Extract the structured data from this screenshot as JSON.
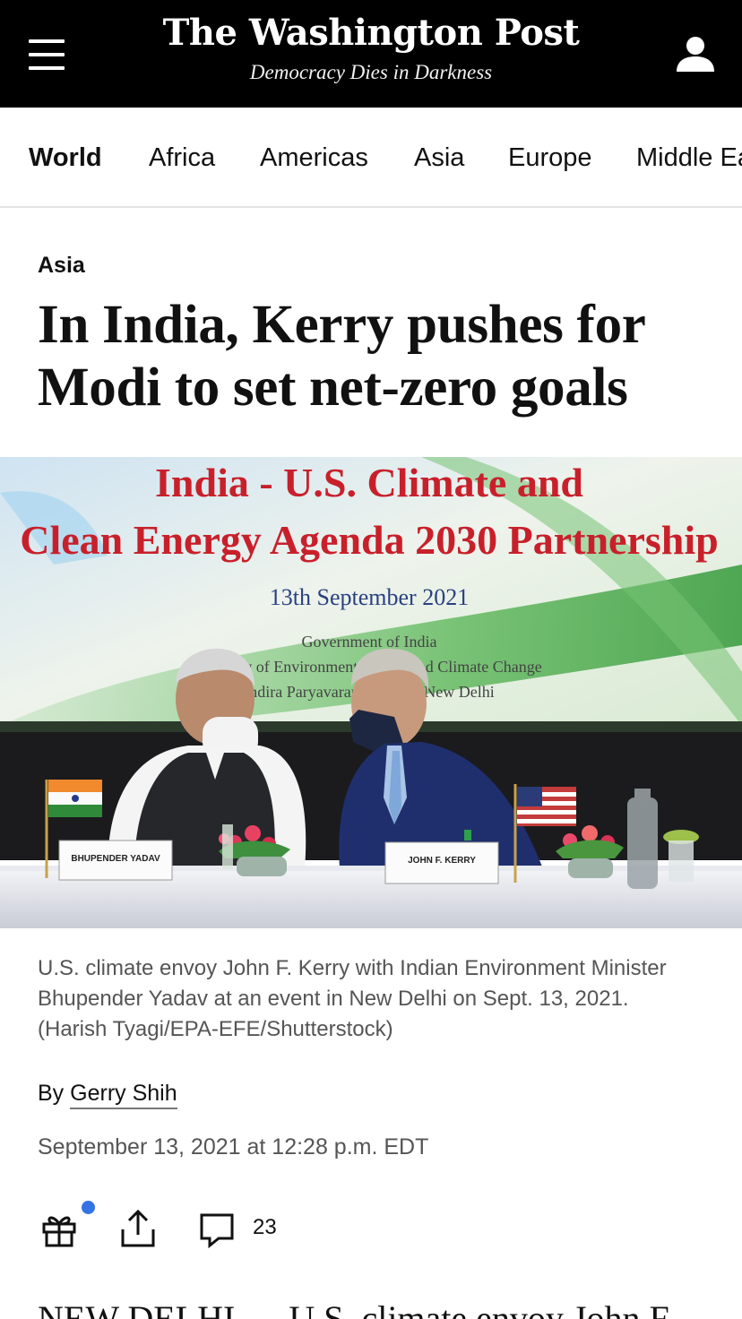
{
  "header": {
    "logo": "The Washington Post",
    "tagline": "Democracy Dies in Darkness",
    "menu_icon": "hamburger-menu-icon",
    "account_icon": "user-account-icon",
    "background_color": "#000000"
  },
  "section_nav": {
    "items": [
      {
        "label": "World",
        "active": true
      },
      {
        "label": "Africa",
        "active": false
      },
      {
        "label": "Americas",
        "active": false
      },
      {
        "label": "Asia",
        "active": false
      },
      {
        "label": "Europe",
        "active": false
      },
      {
        "label": "Middle East",
        "active": false
      }
    ]
  },
  "article": {
    "kicker": "Asia",
    "headline": "In India, Kerry pushes for Modi to set net-zero goals",
    "photo": {
      "banner_line1": "India - U.S. Climate and",
      "banner_line2": "Clean Energy Agenda 2030 Partnership",
      "banner_date": "13th September 2021",
      "banner_org": "Government of India",
      "banner_ministry": "Ministry of Environment, Forest and Climate Change",
      "banner_venue": "Indira Paryavaran Bhawan, New Delhi",
      "nameplate_left": "BHUPENDER YADAV",
      "nameplate_right": "JOHN F. KERRY"
    },
    "caption": "U.S. climate envoy John F. Kerry with Indian Environment Minister Bhupender Yadav at an event in New Delhi on Sept. 13, 2021. (Harish Tyagi/EPA-EFE/Shutterstock)",
    "byline_prefix": "By",
    "author": "Gerry Shih",
    "date": "September 13, 2021 at 12:28 p.m. EDT",
    "actions": {
      "gift_icon": "gift-icon",
      "share_icon": "share-icon",
      "comment_icon": "comment-icon",
      "comment_count": "23",
      "notification_dot_color": "#3473e3"
    },
    "body_start": "NEW DELHI — U.S. climate envoy John F."
  }
}
